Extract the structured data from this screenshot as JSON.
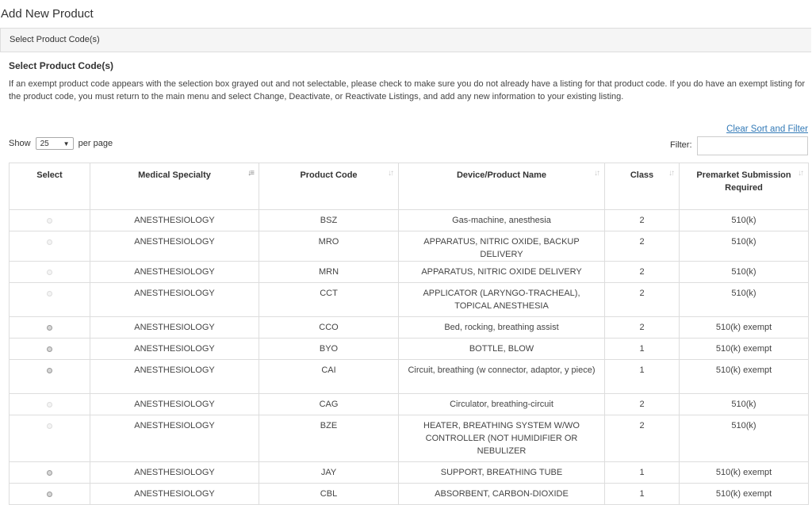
{
  "page": {
    "title": "Add New Product",
    "panel_header": "Select Product Code(s)",
    "section_title": "Select Product Code(s)",
    "instructions": "If an exempt product code appears with the selection box grayed out and not selectable, please check to make sure you do not already have a listing for that product code. If you do have an exempt listing for the product code, you must return to the main menu and select Change, Deactivate, or Reactivate Listings, and add any new information to your existing listing."
  },
  "controls": {
    "clear_link": "Clear Sort and Filter",
    "show_label": "Show",
    "per_page_value": "25",
    "per_page_label": "per page",
    "filter_label": "Filter:",
    "filter_value": ""
  },
  "table": {
    "headers": {
      "select": "Select",
      "specialty": "Medical Specialty",
      "code": "Product Code",
      "name": "Device/Product Name",
      "class": "Class",
      "premarket": "Premarket Submission Required"
    },
    "rows": [
      {
        "selectable": false,
        "specialty": "ANESTHESIOLOGY",
        "code": "BSZ",
        "name": "Gas-machine, anesthesia",
        "class": "2",
        "premarket": "510(k)"
      },
      {
        "selectable": false,
        "specialty": "ANESTHESIOLOGY",
        "code": "MRO",
        "name": "APPARATUS, NITRIC OXIDE, BACKUP DELIVERY",
        "class": "2",
        "premarket": "510(k)"
      },
      {
        "selectable": false,
        "specialty": "ANESTHESIOLOGY",
        "code": "MRN",
        "name": "APPARATUS, NITRIC OXIDE DELIVERY",
        "class": "2",
        "premarket": "510(k)"
      },
      {
        "selectable": false,
        "specialty": "ANESTHESIOLOGY",
        "code": "CCT",
        "name": "APPLICATOR (LARYNGO-TRACHEAL), TOPICAL ANESTHESIA",
        "class": "2",
        "premarket": "510(k)"
      },
      {
        "selectable": true,
        "specialty": "ANESTHESIOLOGY",
        "code": "CCO",
        "name": "Bed, rocking, breathing assist",
        "class": "2",
        "premarket": "510(k) exempt"
      },
      {
        "selectable": true,
        "specialty": "ANESTHESIOLOGY",
        "code": "BYO",
        "name": "BOTTLE, BLOW",
        "class": "1",
        "premarket": "510(k) exempt"
      },
      {
        "selectable": true,
        "specialty": "ANESTHESIOLOGY",
        "code": "CAI",
        "name": "Circuit, breathing (w connector, adaptor, y piece)",
        "class": "1",
        "premarket": "510(k) exempt"
      },
      {
        "selectable": false,
        "specialty": "ANESTHESIOLOGY",
        "code": "CAG",
        "name": "Circulator, breathing-circuit",
        "class": "2",
        "premarket": "510(k)"
      },
      {
        "selectable": false,
        "specialty": "ANESTHESIOLOGY",
        "code": "BZE",
        "name": "HEATER, BREATHING SYSTEM W/WO CONTROLLER (NOT HUMIDIFIER OR NEBULIZER",
        "class": "2",
        "premarket": "510(k)"
      },
      {
        "selectable": true,
        "specialty": "ANESTHESIOLOGY",
        "code": "JAY",
        "name": "SUPPORT, BREATHING TUBE",
        "class": "1",
        "premarket": "510(k) exempt"
      },
      {
        "selectable": true,
        "specialty": "ANESTHESIOLOGY",
        "code": "CBL",
        "name": "ABSORBENT, CARBON-DIOXIDE",
        "class": "1",
        "premarket": "510(k) exempt"
      }
    ]
  },
  "colors": {
    "link": "#337ab7",
    "border": "#dddddd",
    "panel_bg": "#f5f5f5"
  }
}
